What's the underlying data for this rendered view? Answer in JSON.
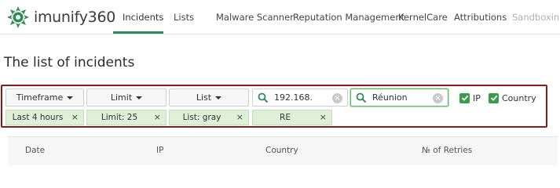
{
  "brand": {
    "logo_text": "imunify360",
    "accent": "#2e8b57"
  },
  "nav": {
    "items": [
      {
        "label": "Incidents",
        "active": true
      },
      {
        "label": "Lists"
      },
      {
        "label": "Malware Scanner"
      },
      {
        "label": "Reputation Management"
      },
      {
        "label": "KernelCare"
      },
      {
        "label": "Attributions"
      },
      {
        "label": "Sandboxing"
      }
    ]
  },
  "page": {
    "title": "The list of incidents"
  },
  "filters": {
    "dropdowns": {
      "timeframe": "Timeframe",
      "limit": "Limit",
      "list": "List"
    },
    "ip_search": {
      "value": "192.168."
    },
    "country_search": {
      "value": "Réunion"
    },
    "checkboxes": {
      "ip": {
        "label": "IP",
        "checked": true
      },
      "country": {
        "label": "Country",
        "checked": true
      }
    },
    "chips": [
      {
        "label": "Last 4 hours"
      },
      {
        "label": "Limit: 25"
      },
      {
        "label": "List: gray"
      },
      {
        "label": "RE"
      }
    ],
    "chip_close": "×",
    "clear_glyph": "×",
    "panel_border_color": "#8b1a1a"
  },
  "table": {
    "columns": [
      "Date",
      "IP",
      "Country",
      "№ of Retries"
    ]
  }
}
